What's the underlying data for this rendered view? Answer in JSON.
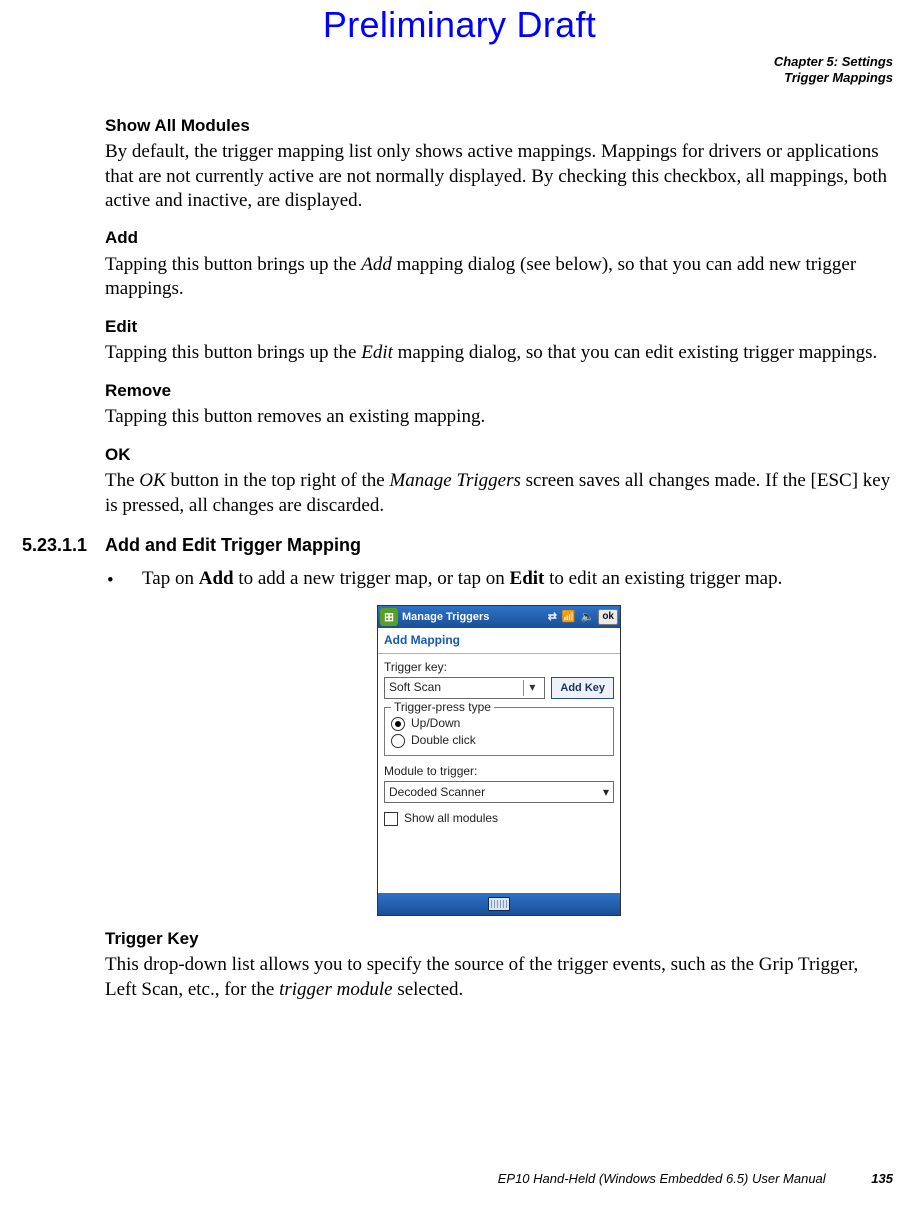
{
  "watermark": "Preliminary Draft",
  "running_head": {
    "line1": "Chapter 5:  Settings",
    "line2": "Trigger Mappings"
  },
  "sections": {
    "show_all": {
      "title": "Show All Modules",
      "body": "By default, the trigger mapping list only shows active mappings. Mappings for drivers or applications that are not currently active are not normally displayed. By checking this checkbox, all mappings, both active and inactive, are displayed."
    },
    "add": {
      "title": "Add",
      "body_pre": "Tapping this button brings up the ",
      "body_ital": "Add",
      "body_post": " mapping dialog (see below), so that you can add new trigger mappings."
    },
    "edit": {
      "title": "Edit",
      "body_pre": "Tapping this button brings up the ",
      "body_ital": "Edit",
      "body_post": " mapping dialog, so that you can edit existing trigger mappings."
    },
    "remove": {
      "title": "Remove",
      "body": "Tapping this button removes an existing mapping."
    },
    "ok": {
      "title": "OK",
      "body_pre": "The ",
      "body_ital1": "OK",
      "body_mid": " button in the top right of the ",
      "body_ital2": "Manage Triggers",
      "body_post": " screen saves all changes made. If the [ESC] key is pressed, all changes are discarded."
    },
    "trigger_key": {
      "title": "Trigger Key",
      "body_pre": "This drop-down list allows you to specify the source of the trigger events, such as the Grip Trigger, Left Scan, etc., for the ",
      "body_ital": "trigger module",
      "body_post": " selected."
    }
  },
  "numbered": {
    "num": "5.23.1.1",
    "title": "Add and Edit Trigger Mapping"
  },
  "bullet": {
    "pre": "Tap on ",
    "b1": "Add",
    "mid": " to add a new trigger map, or tap on ",
    "b2": "Edit",
    "post": " to edit an existing trigger map."
  },
  "screenshot": {
    "title": "Manage Triggers",
    "ok_label": "ok",
    "tab": "Add Mapping",
    "trigger_key_label": "Trigger key:",
    "trigger_key_value": "Soft Scan",
    "add_key_btn": "Add Key",
    "press_type_legend": "Trigger-press type",
    "radio_updown": "Up/Down",
    "radio_double": "Double click",
    "module_label": "Module to trigger:",
    "module_value": "Decoded Scanner",
    "show_all_label": "Show all modules"
  },
  "footer": {
    "text": "EP10 Hand-Held (Windows Embedded 6.5) User Manual",
    "page": "135"
  }
}
